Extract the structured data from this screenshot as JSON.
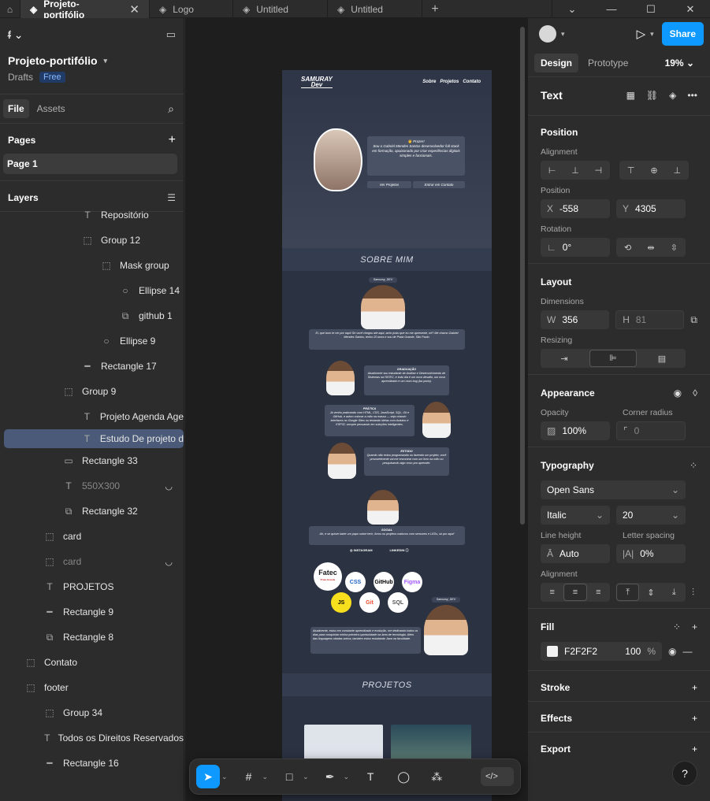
{
  "tabs": [
    {
      "label": "Projeto-portifólio",
      "active": true
    },
    {
      "label": "Logo"
    },
    {
      "label": "Untitled"
    },
    {
      "label": "Untitled"
    }
  ],
  "project": {
    "name": "Projeto-portifólio",
    "location": "Drafts",
    "plan": "Free"
  },
  "file_tabs": {
    "file": "File",
    "assets": "Assets"
  },
  "pages": {
    "title": "Pages",
    "items": [
      "Page 1"
    ]
  },
  "layers": {
    "title": "Layers",
    "items": [
      {
        "label": "Repositório",
        "icon": "text-icon",
        "indent": 104
      },
      {
        "label": "Group 12",
        "icon": "group-icon",
        "indent": 104
      },
      {
        "label": "Mask group",
        "icon": "group-icon",
        "indent": 128
      },
      {
        "label": "Ellipse 14",
        "icon": "ellipse-icon",
        "indent": 152
      },
      {
        "label": "github 1",
        "icon": "image-icon",
        "indent": 152
      },
      {
        "label": "Ellipse 9",
        "icon": "ellipse-icon",
        "indent": 128
      },
      {
        "label": "Rectangle 17",
        "icon": "line-icon",
        "indent": 104
      },
      {
        "label": "Group 9",
        "icon": "group-icon",
        "indent": 80
      },
      {
        "label": "Projeto Agenda Age",
        "icon": "text-icon",
        "indent": 104
      },
      {
        "label": "Estudo De projeto d",
        "icon": "text-icon",
        "indent": 104,
        "selected": true
      },
      {
        "label": "Rectangle 33",
        "icon": "rect-icon",
        "indent": 80
      },
      {
        "label": "550X300",
        "icon": "text-icon",
        "indent": 80,
        "hidden": true
      },
      {
        "label": "Rectangle 32",
        "icon": "image-icon",
        "indent": 80
      },
      {
        "label": "card",
        "icon": "group-icon",
        "indent": 56
      },
      {
        "label": "card",
        "icon": "group-icon",
        "indent": 56,
        "hidden": true
      },
      {
        "label": "PROJETOS",
        "icon": "text-icon",
        "indent": 56
      },
      {
        "label": "Rectangle 9",
        "icon": "line-icon",
        "indent": 56
      },
      {
        "label": "Rectangle 8",
        "icon": "image-icon",
        "indent": 56
      },
      {
        "label": "Contato",
        "icon": "group-icon",
        "indent": 32
      },
      {
        "label": "footer",
        "icon": "group-icon",
        "indent": 32
      },
      {
        "label": "Group 34",
        "icon": "group-icon",
        "indent": 56
      },
      {
        "label": "Todos os Direitos Reservados",
        "icon": "text-icon",
        "indent": 56
      },
      {
        "label": "Rectangle 16",
        "icon": "line-icon",
        "indent": 56
      }
    ]
  },
  "canvas": {
    "nav_logo_top": "SAMURAY",
    "nav_logo_bottom": "Dev",
    "nav_links": [
      "Sobre",
      "Projetos",
      "Contato"
    ],
    "hero_greeting": "👋 Prazer!",
    "hero_text": "Sou o Gabriel Mendes Santos desenvolvedor full stack em formação, apaixonado por criar experiências digitais simples e funcionais.",
    "hero_btn_projects": "Ver Projetos",
    "hero_btn_contact": "Entrar em Contato",
    "about_title": "SOBRE MIM",
    "about_tag": "Samuray_DEV",
    "about_intro": "Ei, que bom te ver por aqui! Se você chegou até aqui, acho justo que eu me apresente, né? Me chamo Gabriel Mendes Santos, tenho 20 anos e sou de Praia Grande, São Paulo.",
    "grad_title": "GRADUAÇÃO",
    "grad_text": "Atualmente sou estudante de Análise e Desenvolvimento de Sistemas na FATEC, e todo dia é um novo desafio, um novo aprendizado e um novo bug (ba porta).",
    "practice_title": "PRÁTICA",
    "practice_text": "Já venho praticando com HTML, CSS, JavaScript, SQL, Git e GitHub, e adoro colocar a mão na massa — seja criando interfaces no Google Sites ou testando ideias com Arduino e ESP32, sempre pensando em soluções inteligentes.",
    "study_title": "ESTUDO",
    "study_text": "Quando não estou programando ou fazendo um projeto, você provavelmente vai me encontrar com um livro na mão ou pesquisando algo novo pra aprender.",
    "social_title": "SOCIAL",
    "social_text": "Ah, e se quiser bater um papo sobre tech, livros ou projetos malucos com sensores e LEDs, só por aqui!",
    "social_links": [
      "INSTAGRAM",
      "LINKEDIN"
    ],
    "tech_labels": [
      "Fatec",
      "CSS",
      "GitHub",
      "Figma",
      "JS",
      "Git",
      "SQL"
    ],
    "fatec_sub": "Praia Grande",
    "closing_tag": "Samuray_DEV",
    "closing_text": "Atualmente, estou em constante aprendizado e evolução, me dedicando todos os dias para conquistar minha primeira oportunidade na área de tecnologia. Além das linguagens citadas acima, também estou estudando Java na faculdade.",
    "projects_title": "PROJETOS"
  },
  "right": {
    "share": "Share",
    "tabs": [
      "Design",
      "Prototype"
    ],
    "zoom": "19%",
    "layer_type": "Text",
    "position": {
      "title": "Position",
      "alignment_label": "Alignment",
      "position_label": "Position",
      "x_label": "X",
      "x": "-558",
      "y_label": "Y",
      "y": "4305",
      "rotation_label": "Rotation",
      "rotation": "0°"
    },
    "layout": {
      "title": "Layout",
      "dimensions_label": "Dimensions",
      "w_label": "W",
      "w": "356",
      "h_label": "H",
      "h": "81",
      "resizing_label": "Resizing"
    },
    "appearance": {
      "title": "Appearance",
      "opacity_label": "Opacity",
      "opacity": "100%",
      "radius_label": "Corner radius",
      "radius": "0"
    },
    "typography": {
      "title": "Typography",
      "font": "Open Sans",
      "style": "Italic",
      "size": "20",
      "line_height_label": "Line height",
      "line_height": "Auto",
      "letter_spacing_label": "Letter spacing",
      "letter_spacing": "0%",
      "alignment_label": "Alignment"
    },
    "fill": {
      "title": "Fill",
      "hex": "F2F2F2",
      "opacity": "100",
      "unit": "%",
      "swatch": "#F2F2F2"
    },
    "stroke": "Stroke",
    "effects": "Effects",
    "export": "Export"
  },
  "colors": {
    "accent": "#0d99ff",
    "selection": "#4a5a78"
  }
}
